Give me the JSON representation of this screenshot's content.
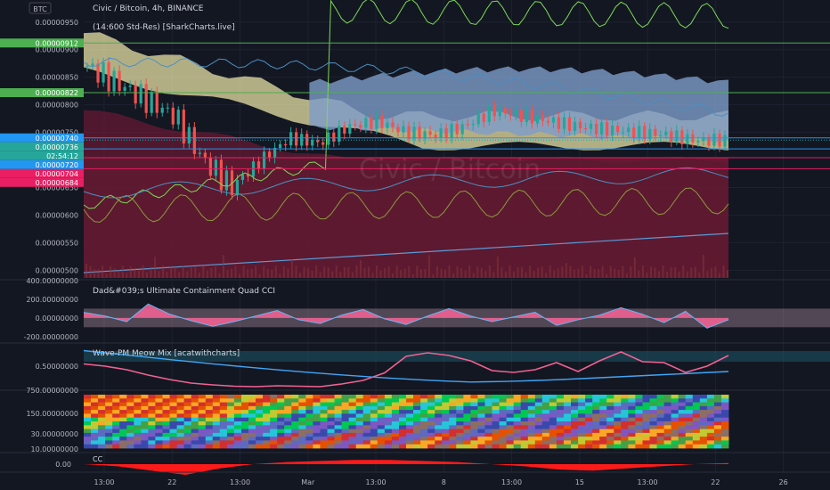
{
  "header": {
    "symbol_badge": "BTC",
    "title": "Civic / Bitcoin, 4h, BINANCE",
    "indicator_label": "(14:600 Std-Res) [SharkCharts.live]",
    "watermark": "Civic / Bitcoin"
  },
  "colors": {
    "background": "#131722",
    "grid": "#1e2230",
    "green_line": "#4caf50",
    "red_line": "#e91e63",
    "blue_label": "#2196f3",
    "red_band": "#6b1a33",
    "yellow_cloud": "#e8e2a6",
    "blue_cloud": "#7d9cc9",
    "candle_up": "#26a69a",
    "candle_down": "#ef5350"
  },
  "chart_data": [
    {
      "type": "line",
      "panel": "price",
      "title": "Civic / Bitcoin, 4h, BINANCE",
      "y_ticks": [
        "0.00000950",
        "0.00000900",
        "0.00000850",
        "0.00000800",
        "0.00000750",
        "0.00000650",
        "0.00000600",
        "0.00000550",
        "0.00000500"
      ],
      "ylim": [
        4.86e-06,
        9.9e-06
      ],
      "price_labels": [
        {
          "text": "0.00000912",
          "value": 9.12e-06,
          "color": "#4caf50"
        },
        {
          "text": "0.00000822",
          "value": 8.22e-06,
          "color": "#4caf50"
        },
        {
          "text": "0.00000740",
          "value": 7.4e-06,
          "color": "#2196f3"
        },
        {
          "text": "0.00000736",
          "value": 7.36e-06,
          "color": "#26a69a"
        },
        {
          "text": "02:54:12",
          "value": 7.28e-06,
          "color": "#26a69a"
        },
        {
          "text": "0.00000720",
          "value": 7.2e-06,
          "color": "#2196f3"
        },
        {
          "text": "0.00000704",
          "value": 7.04e-06,
          "color": "#e91e63"
        },
        {
          "text": "0.00000684",
          "value": 6.84e-06,
          "color": "#e91e63"
        }
      ],
      "horizontal_lines": [
        {
          "value": 9.12e-06,
          "color": "#4caf50"
        },
        {
          "value": 8.22e-06,
          "color": "#4caf50"
        },
        {
          "value": 7.4e-06,
          "color": "#2196f3"
        },
        {
          "value": 7.2e-06,
          "color": "#2196f3"
        },
        {
          "value": 7.04e-06,
          "color": "#e91e63"
        },
        {
          "value": 6.84e-06,
          "color": "#e91e63"
        }
      ],
      "close_series": [
        8.7e-06,
        8.4e-06,
        8.1e-06,
        7.8e-06,
        7e-06,
        6.5e-06,
        7e-06,
        7.4e-06,
        7.3e-06,
        7.6e-06,
        7.7e-06,
        7.5e-06,
        7.45e-06,
        7.6e-06,
        7.9e-06,
        7.8e-06,
        7.7e-06,
        7.6e-06,
        7.55e-06,
        7.5e-06,
        7.45e-06,
        7.35e-06,
        7.36e-06
      ]
    },
    {
      "type": "area",
      "panel": "cci",
      "title": "Dad&#039;s Ultimate Containment Quad CCI",
      "y_ticks": [
        "400.00000000",
        "200.00000000",
        "0.00000000",
        "-200.00000000"
      ],
      "ylim": [
        -250,
        400
      ],
      "values": [
        60,
        20,
        -40,
        150,
        40,
        -30,
        -90,
        -40,
        20,
        80,
        -20,
        -60,
        30,
        90,
        -10,
        -70,
        20,
        100,
        20,
        -40,
        10,
        60,
        -80,
        -20,
        30,
        110,
        40,
        -50,
        70,
        -110,
        -20
      ]
    },
    {
      "type": "line",
      "panel": "wavepm",
      "title": "Wave-PM Meow Mix [acatwithcharts]",
      "y_ticks": [
        "0.50000000"
      ],
      "ylim": [
        0,
        1
      ],
      "values": [
        0.55,
        0.5,
        0.42,
        0.3,
        0.2,
        0.12,
        0.08,
        0.05,
        0.04,
        0.06,
        0.05,
        0.04,
        0.1,
        0.18,
        0.35,
        0.72,
        0.8,
        0.74,
        0.62,
        0.4,
        0.36,
        0.42,
        0.58,
        0.38,
        0.62,
        0.82,
        0.6,
        0.58,
        0.36,
        0.5,
        0.74
      ]
    },
    {
      "type": "heatmap",
      "panel": "heatmap",
      "y_ticks": [
        "750.00000000",
        "150.00000000",
        "30.00000000",
        "10.00000000"
      ]
    },
    {
      "type": "area",
      "panel": "cc",
      "title": "CC",
      "y_ticks": [
        "0.00"
      ],
      "values": [
        0,
        -2,
        -6,
        -10,
        -4,
        0,
        2,
        3,
        4,
        4,
        3,
        2,
        0,
        -2,
        -5,
        -6,
        -4,
        -2,
        0,
        1
      ]
    }
  ],
  "x_axis": {
    "ticks": [
      "13:00",
      "22",
      "13:00",
      "Mar",
      "13:00",
      "8",
      "13:00",
      "15",
      "13:00",
      "22",
      "26"
    ]
  }
}
